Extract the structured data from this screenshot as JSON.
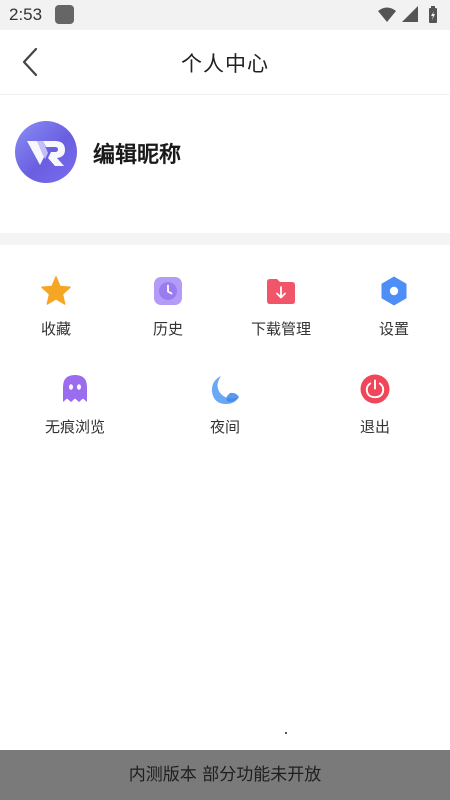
{
  "status_bar": {
    "time": "2:53"
  },
  "header": {
    "title": "个人中心"
  },
  "profile": {
    "nickname": "编辑昵称"
  },
  "menu": {
    "row1": [
      {
        "label": "收藏",
        "icon": "star-icon",
        "color": "#f5a623"
      },
      {
        "label": "历史",
        "icon": "clock-icon",
        "color": "#9b7cf0"
      },
      {
        "label": "下载管理",
        "icon": "download-folder-icon",
        "color": "#f0556a"
      },
      {
        "label": "设置",
        "icon": "settings-hexagon-icon",
        "color": "#4d8ef7"
      }
    ],
    "row2": [
      {
        "label": "无痕浏览",
        "icon": "ghost-icon",
        "color": "#9b6cf0"
      },
      {
        "label": "夜间",
        "icon": "moon-icon",
        "color": "#6aa8f5"
      },
      {
        "label": "退出",
        "icon": "power-icon",
        "color": "#f0465a"
      }
    ]
  },
  "footer": {
    "notice": "内测版本 部分功能未开放"
  }
}
